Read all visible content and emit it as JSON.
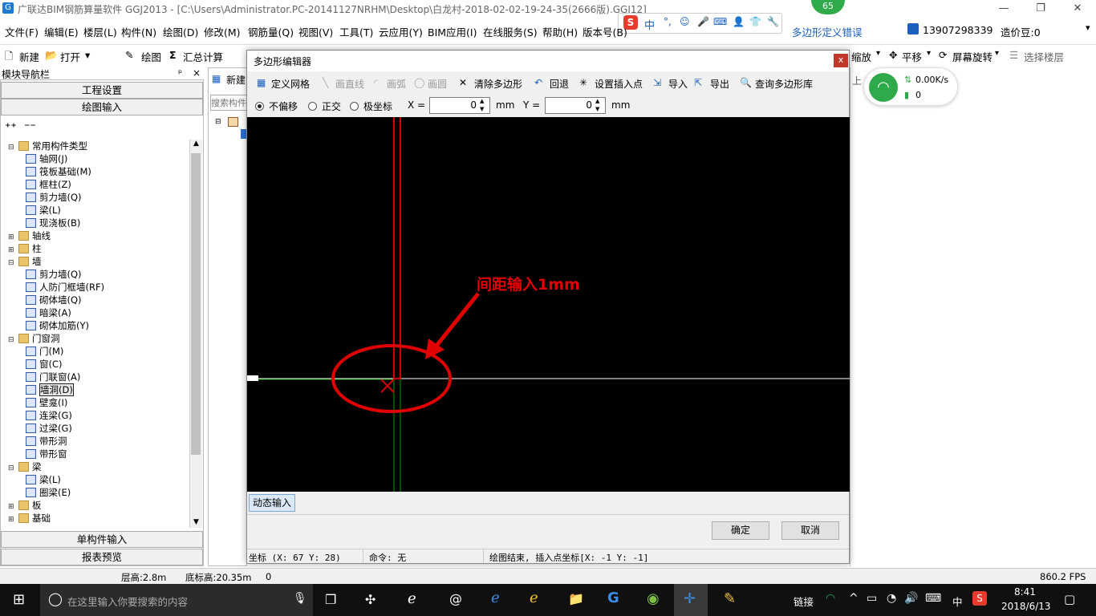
{
  "window": {
    "title": "广联达BIM钢筋算量软件 GGJ2013 - [C:\\Users\\Administrator.PC-20141127NRHM\\Desktop\\白龙村-2018-02-02-19-24-35(2666版).GGJ12]",
    "minimize": "—",
    "maximize": "❐",
    "close": "✕",
    "badge": "65"
  },
  "menu": [
    "文件(F)",
    "编辑(E)",
    "楼层(L)",
    "构件(N)",
    "绘图(D)",
    "修改(M)",
    "钢筋量(Q)",
    "视图(V)",
    "工具(T)",
    "云应用(Y)",
    "BIM应用(I)",
    "在线服务(S)",
    "帮助(H)",
    "版本号(B)"
  ],
  "menu_right": {
    "link": "多边形定义错误",
    "phone": "13907298339",
    "price": "造价豆:0"
  },
  "toolbar": {
    "new": "新建",
    "open": "打开",
    "draw": "绘图",
    "sum": "汇总计算",
    "zoom": "缩放",
    "pan": "平移",
    "rotate": "屏幕旋转",
    "select_floor": "选择楼层"
  },
  "nav": {
    "header": "模块导航栏",
    "pin": "ᵖ",
    "close": "×",
    "btn_project": "工程设置",
    "btn_draw": "绘图输入",
    "btn_single": "单构件输入",
    "btn_report": "报表预览",
    "tree": [
      {
        "label": "常用构件类型",
        "level": 0,
        "exp": "⊟",
        "type": "folder"
      },
      {
        "label": "轴网(J)",
        "level": 1,
        "type": "comp"
      },
      {
        "label": "筏板基础(M)",
        "level": 1,
        "type": "comp"
      },
      {
        "label": "框柱(Z)",
        "level": 1,
        "type": "comp"
      },
      {
        "label": "剪力墙(Q)",
        "level": 1,
        "type": "comp"
      },
      {
        "label": "梁(L)",
        "level": 1,
        "type": "comp"
      },
      {
        "label": "现浇板(B)",
        "level": 1,
        "type": "comp"
      },
      {
        "label": "轴线",
        "level": 0,
        "exp": "⊞",
        "type": "folder"
      },
      {
        "label": "柱",
        "level": 0,
        "exp": "⊞",
        "type": "folder"
      },
      {
        "label": "墙",
        "level": 0,
        "exp": "⊟",
        "type": "folder"
      },
      {
        "label": "剪力墙(Q)",
        "level": 1,
        "type": "comp"
      },
      {
        "label": "人防门框墙(RF)",
        "level": 1,
        "type": "comp"
      },
      {
        "label": "砌体墙(Q)",
        "level": 1,
        "type": "comp"
      },
      {
        "label": "暗梁(A)",
        "level": 1,
        "type": "comp"
      },
      {
        "label": "砌体加筋(Y)",
        "level": 1,
        "type": "comp"
      },
      {
        "label": "门窗洞",
        "level": 0,
        "exp": "⊟",
        "type": "folder"
      },
      {
        "label": "门(M)",
        "level": 1,
        "type": "comp"
      },
      {
        "label": "窗(C)",
        "level": 1,
        "type": "comp"
      },
      {
        "label": "门联窗(A)",
        "level": 1,
        "type": "comp"
      },
      {
        "label": "墙洞(D)",
        "level": 1,
        "type": "comp",
        "selected": true
      },
      {
        "label": "壁龛(I)",
        "level": 1,
        "type": "comp"
      },
      {
        "label": "连梁(G)",
        "level": 1,
        "type": "comp"
      },
      {
        "label": "过梁(G)",
        "level": 1,
        "type": "comp"
      },
      {
        "label": "带形洞",
        "level": 1,
        "type": "comp"
      },
      {
        "label": "带形窗",
        "level": 1,
        "type": "comp"
      },
      {
        "label": "梁",
        "level": 0,
        "exp": "⊟",
        "type": "folder"
      },
      {
        "label": "梁(L)",
        "level": 1,
        "type": "comp"
      },
      {
        "label": "圈梁(E)",
        "level": 1,
        "type": "comp"
      },
      {
        "label": "板",
        "level": 0,
        "exp": "⊞",
        "type": "folder"
      },
      {
        "label": "基础",
        "level": 0,
        "exp": "⊞",
        "type": "folder"
      }
    ]
  },
  "mid": {
    "new": "新建",
    "search_placeholder": "搜索构件"
  },
  "dialog": {
    "title": "多边形编辑器",
    "close": "x",
    "tools": [
      "定义网格",
      "画直线",
      "画弧",
      "画圆",
      "清除多边形",
      "回退",
      "设置插入点",
      "导入",
      "导出",
      "查询多边形库"
    ],
    "radio": [
      "不偏移",
      "正交",
      "极坐标"
    ],
    "x_label": "X =",
    "x_value": "0",
    "x_unit": "mm",
    "y_label": "Y =",
    "y_value": "0",
    "y_unit": "mm",
    "annotation": "间距输入1mm",
    "dyn_input": "动态输入",
    "ok": "确定",
    "cancel": "取消",
    "status_coord": "坐标 (X: 67 Y: 28)",
    "status_cmd": "命令: 无",
    "status_msg": "绘图结束, 插入点坐标[X: -1 Y: -1]",
    "colors": {
      "outline": "#d00000",
      "grid": "#00a000",
      "axis": "#ffffff"
    }
  },
  "net": {
    "speed": "0.00K/s",
    "count": "0"
  },
  "status": {
    "floor": "层高:2.8m",
    "base": "底标高:20.35m",
    "zero": "0",
    "fps": "860.2 FPS"
  },
  "ime_text": "中",
  "taskbar": {
    "search": "在这里输入你要搜索的内容",
    "link": "链接",
    "lang": "中",
    "time": "8:41",
    "date": "2018/6/13"
  },
  "right_partial": "上"
}
